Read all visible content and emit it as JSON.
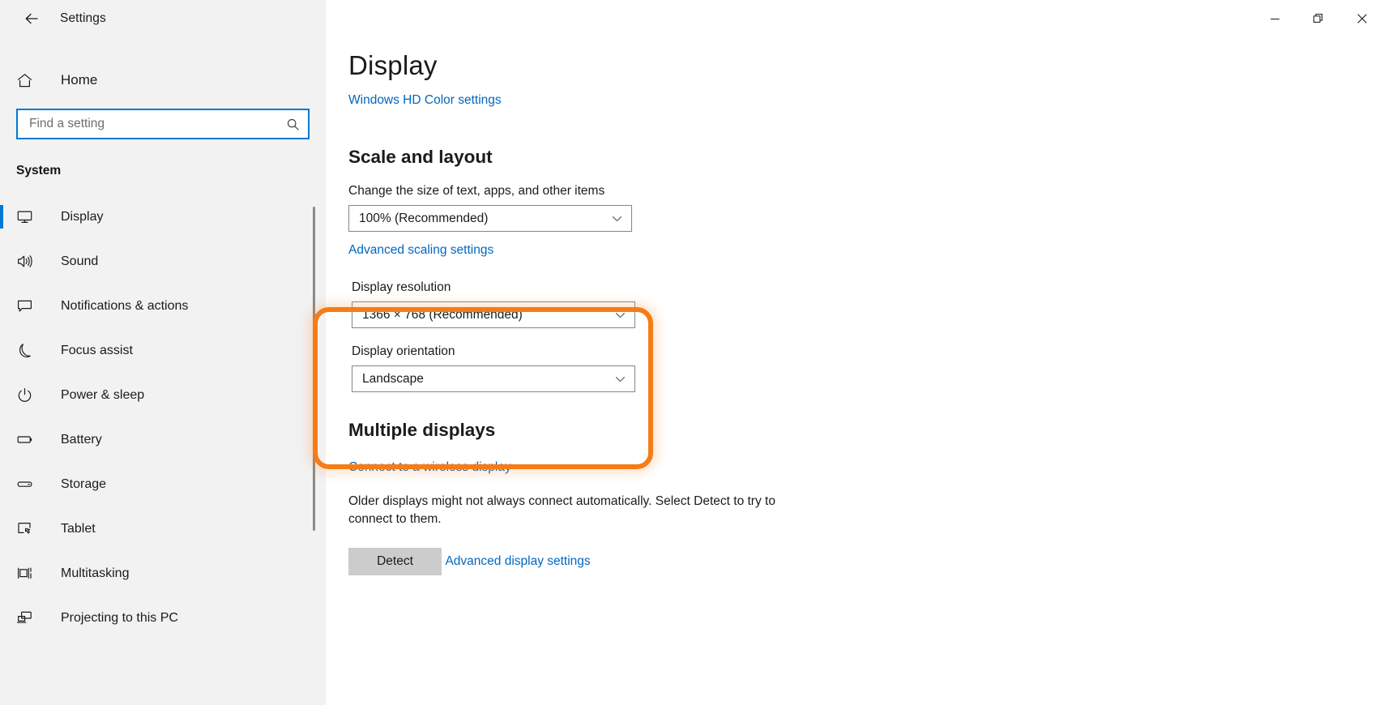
{
  "window": {
    "title": "Settings",
    "back_icon": "back-arrow-icon",
    "controls": {
      "minimize_label": "Minimize",
      "restore_label": "Restore",
      "close_label": "Close"
    }
  },
  "sidebar": {
    "home_label": "Home",
    "home_icon": "home-icon",
    "search": {
      "placeholder": "Find a setting",
      "value": "",
      "icon": "search-icon"
    },
    "group_heading": "System",
    "items": [
      {
        "label": "Display",
        "icon": "monitor-icon",
        "selected": true
      },
      {
        "label": "Sound",
        "icon": "speaker-icon",
        "selected": false
      },
      {
        "label": "Notifications & actions",
        "icon": "chat-bubble-icon",
        "selected": false
      },
      {
        "label": "Focus assist",
        "icon": "moon-icon",
        "selected": false
      },
      {
        "label": "Power & sleep",
        "icon": "power-icon",
        "selected": false
      },
      {
        "label": "Battery",
        "icon": "battery-icon",
        "selected": false
      },
      {
        "label": "Storage",
        "icon": "drive-icon",
        "selected": false
      },
      {
        "label": "Tablet",
        "icon": "tablet-icon",
        "selected": false
      },
      {
        "label": "Multitasking",
        "icon": "multitasking-icon",
        "selected": false
      },
      {
        "label": "Projecting to this PC",
        "icon": "projecting-icon",
        "selected": false
      }
    ]
  },
  "main": {
    "page_title": "Display",
    "hd_color_link": "Windows HD Color settings",
    "scale_section": {
      "title": "Scale and layout",
      "scale_label": "Change the size of text, apps, and other items",
      "scale_value": "100% (Recommended)",
      "advanced_scaling_link": "Advanced scaling settings"
    },
    "resolution_section": {
      "resolution_label": "Display resolution",
      "resolution_value": "1366 × 768 (Recommended)",
      "orientation_label": "Display orientation",
      "orientation_value": "Landscape",
      "highlight_color": "#f57c16"
    },
    "multiple_displays": {
      "title": "Multiple displays",
      "wireless_link": "Connect to a wireless display",
      "description": "Older displays might not always connect automatically. Select Detect to try to connect to them.",
      "detect_button": "Detect"
    },
    "advanced_display_link": "Advanced display settings"
  },
  "colors": {
    "accent": "#0078d4",
    "link": "#0067c0",
    "highlight": "#f57c16",
    "sidebar_bg": "#f2f2f2"
  }
}
